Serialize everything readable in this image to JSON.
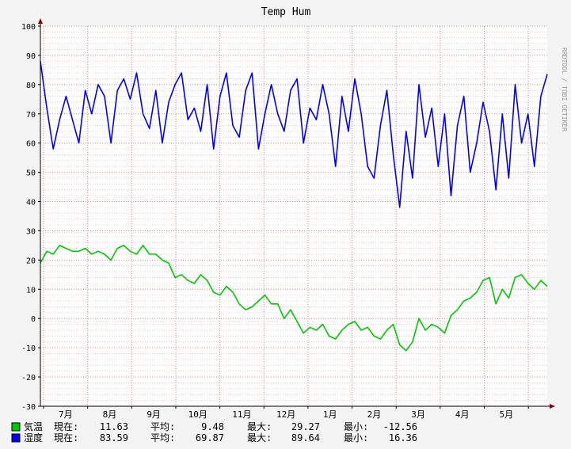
{
  "chart_data": {
    "type": "line",
    "title": "Temp Hum",
    "watermark": "RRDTOOL / TOBI OETIKER",
    "ylim": [
      -30,
      100
    ],
    "yticks": [
      -30,
      -20,
      -10,
      0,
      10,
      20,
      30,
      40,
      50,
      60,
      70,
      80,
      90,
      100
    ],
    "x_month_labels": [
      "7月",
      "8月",
      "9月",
      "10月",
      "11月",
      "12月",
      "1月",
      "2月",
      "3月",
      "4月",
      "5月"
    ],
    "grid": true,
    "colors": {
      "background": "#f4f4f4",
      "plot_bg": "#ffffff",
      "minor_grid": "#e6c6c6",
      "major_grid": "#e08080",
      "axis": "#000000",
      "arrow": "#880000",
      "temp": "#00c800",
      "hum": "#0000ff"
    },
    "series": [
      {
        "name": "気温",
        "color": "#00c800",
        "values": [
          19,
          23,
          22,
          25,
          24,
          23,
          23,
          24,
          22,
          23,
          22,
          20,
          24,
          25,
          23,
          22,
          25,
          22,
          22,
          20,
          19,
          14,
          15,
          13,
          12,
          15,
          13,
          9,
          8,
          11,
          9,
          5,
          3,
          4,
          6,
          8,
          5,
          5,
          0,
          3,
          -1,
          -5,
          -3,
          -4,
          -2,
          -6,
          -7,
          -4,
          -2,
          -1,
          -4,
          -3,
          -6,
          -7,
          -4,
          -2,
          -9,
          -11,
          -8,
          0,
          -4,
          -2,
          -3,
          -5,
          1,
          3,
          6,
          7,
          9,
          13,
          14,
          5,
          10,
          7,
          14,
          15,
          12,
          10,
          13,
          11
        ],
        "current": "11.63",
        "average": "9.48",
        "max": "29.27",
        "min": "-12.56"
      },
      {
        "name": "湿度",
        "color": "#0000ff",
        "values": [
          88,
          72,
          58,
          68,
          76,
          68,
          60,
          78,
          70,
          80,
          76,
          60,
          78,
          82,
          75,
          84,
          70,
          65,
          78,
          60,
          74,
          80,
          84,
          68,
          72,
          64,
          80,
          58,
          76,
          84,
          66,
          62,
          78,
          84,
          58,
          70,
          80,
          70,
          64,
          78,
          82,
          60,
          72,
          68,
          80,
          70,
          52,
          76,
          64,
          82,
          70,
          52,
          48,
          66,
          78,
          56,
          38,
          64,
          48,
          80,
          62,
          72,
          52,
          70,
          42,
          66,
          76,
          50,
          60,
          74,
          64,
          44,
          70,
          48,
          80,
          60,
          70,
          52,
          76,
          83.59
        ],
        "current": "83.59",
        "average": "69.87",
        "max": "89.64",
        "min": "16.36"
      }
    ],
    "legend_labels": {
      "current": "現在:",
      "average": "平均:",
      "max": "最大:",
      "min": "最小:"
    }
  }
}
